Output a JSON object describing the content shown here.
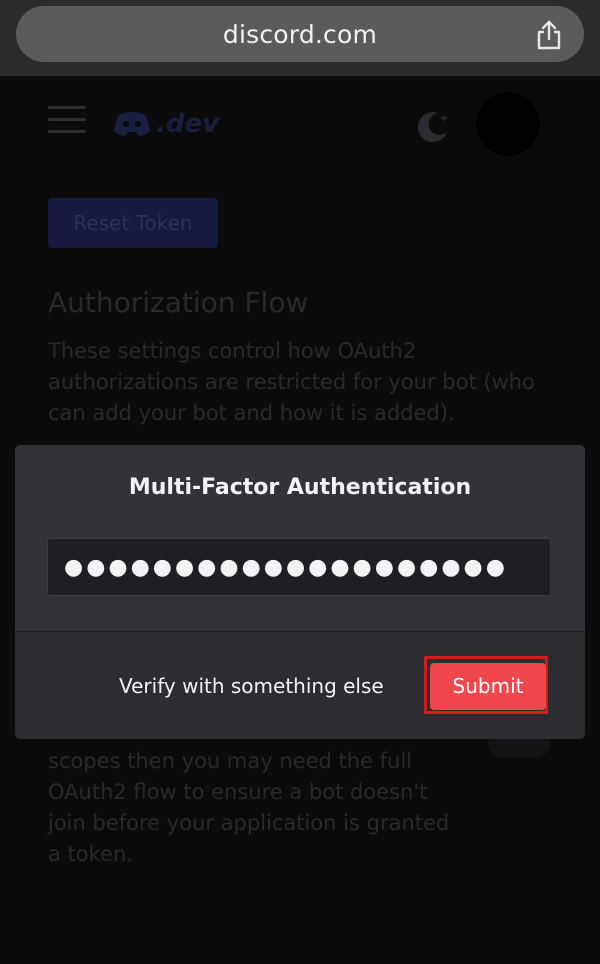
{
  "browser": {
    "url": "discord.com"
  },
  "header": {
    "logo_text": ".dev"
  },
  "page": {
    "reset_token_label": "Reset Token",
    "section_title": "Authorization Flow",
    "section_description": "These settings control how OAuth2 authorizations are restricted for your bot (who can add your bot and how it is added).",
    "section_description_2": "scopes then you may need the full OAuth2 flow to ensure a bot doesn't join before your application is granted a token."
  },
  "modal": {
    "title": "Multi-Factor Authentication",
    "password_value": "●●●●●●●●●●●●●●●●●●●●",
    "verify_link_label": "Verify with something else",
    "submit_label": "Submit"
  },
  "colors": {
    "accent": "#f0474d",
    "highlight": "#d21c1c",
    "modal_bg": "#313338"
  }
}
